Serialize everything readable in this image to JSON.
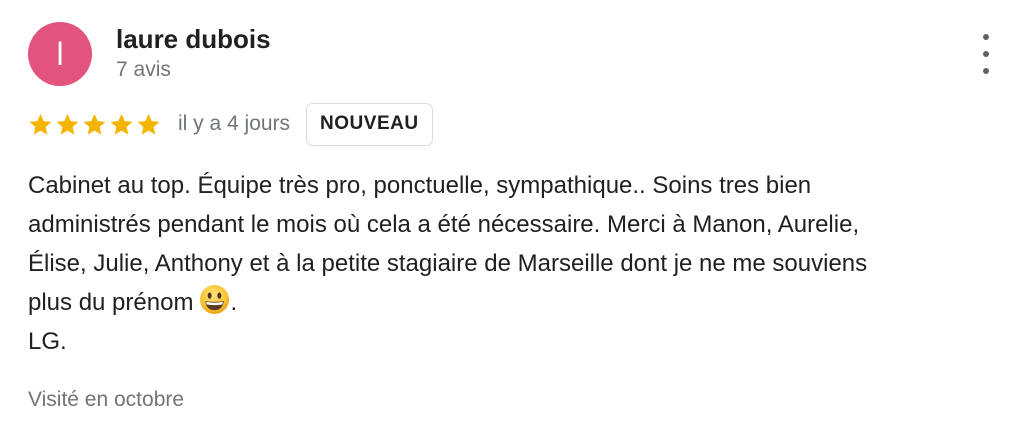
{
  "author": {
    "initial": "l",
    "name": "laure dubois",
    "review_count": "7 avis",
    "avatar_color": "#e2547d"
  },
  "rating": {
    "stars": 5,
    "max": 5,
    "star_color": "#f5b400"
  },
  "date": "il y a 4 jours",
  "badge": "NOUVEAU",
  "review": {
    "lines": [
      "Cabinet au top. Équipe très pro, ponctuelle, sympathique.. Soins tres bien",
      "administrés pendant le mois où cela a été nécessaire. Merci à Manon, Aurelie,",
      "Élise, Julie, Anthony et à la petite stagiaire de Marseille dont je ne me souviens",
      "plus du prénom",
      "LG."
    ],
    "emoji": "grinning-face",
    "after_emoji": "."
  },
  "visit": "Visité en octobre",
  "menu_icon": "more-vert-icon"
}
